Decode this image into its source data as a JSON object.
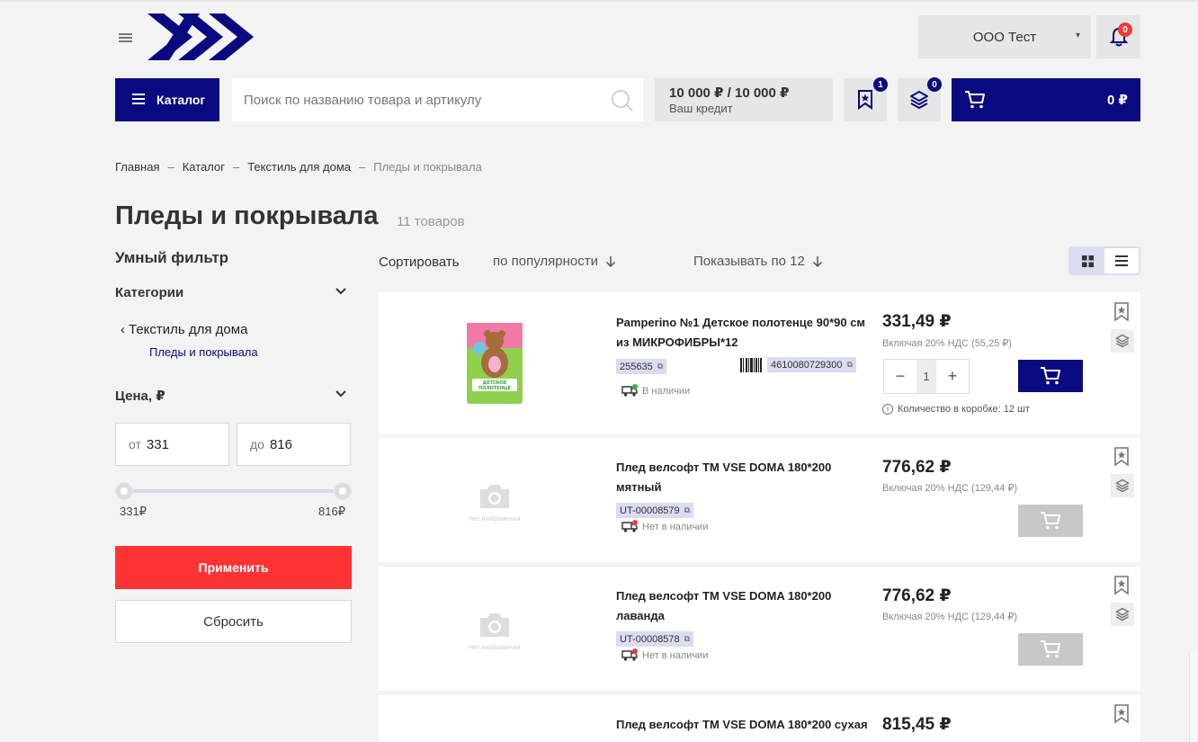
{
  "header": {
    "company": "ООО Тест",
    "notifications_count": "0",
    "catalog_label": "Каталог",
    "search_placeholder": "Поиск по названию товара и артикулу",
    "credit_amount": "10 000 ₽ / 10 000 ₽",
    "credit_label": "Ваш кредит",
    "favorites_count": "1",
    "compare_count": "0",
    "cart_total": "0 ₽"
  },
  "breadcrumb": [
    "Главная",
    "Каталог",
    "Текстиль для дома",
    "Пледы и покрывала"
  ],
  "page": {
    "title": "Пледы и покрывала",
    "count": "11 товаров"
  },
  "filter": {
    "title": "Умный фильтр",
    "categories_label": "Категории",
    "parent_category": "Текстиль для дома",
    "child_category": "Пледы и покрывала",
    "price_label": "Цена, ₽",
    "from_prefix": "от",
    "from_value": "331",
    "to_prefix": "до",
    "to_value": "816",
    "range_min_label": "331₽",
    "range_max_label": "816₽",
    "apply_label": "Применить",
    "reset_label": "Сбросить"
  },
  "sort": {
    "label": "Сортировать",
    "by": "по популярности",
    "per_page": "Показывать по 12"
  },
  "no_image_text": "Нет изображения",
  "products": [
    {
      "name": "Pamperino №1 Детское полотенце 90*90 см из МИКРОФИБРЫ*12",
      "sku": "255635",
      "barcode": "4610080729300",
      "stock": "В наличии",
      "price": "331,49 ₽",
      "vat": "Включая 20% НДС (55,25 ₽)",
      "qty": "1",
      "box_info": "Количество в коробке: 12 шт",
      "in_stock": true,
      "image_caption": "ДЕТСКОЕ ПОЛОТЕНЦЕ"
    },
    {
      "name": "Плед велсофт TM VSE DOMA 180*200 мятный",
      "sku": "UT-00008579",
      "stock": "Нет в наличии",
      "price": "776,62 ₽",
      "vat": "Включая 20% НДС (129,44 ₽)",
      "in_stock": false
    },
    {
      "name": "Плед велсофт TM VSE DOMA 180*200 лаванда",
      "sku": "UT-00008578",
      "stock": "Нет в наличии",
      "price": "776,62 ₽",
      "vat": "Включая 20% НДС (129,44 ₽)",
      "in_stock": false
    },
    {
      "name": "Плед велсофт TM VSE DOMA 180*200 сухая",
      "price": "815,45 ₽",
      "in_stock": false
    }
  ],
  "colors": {
    "brand_navy": "#0a0a80",
    "accent_red": "#ff3333"
  }
}
